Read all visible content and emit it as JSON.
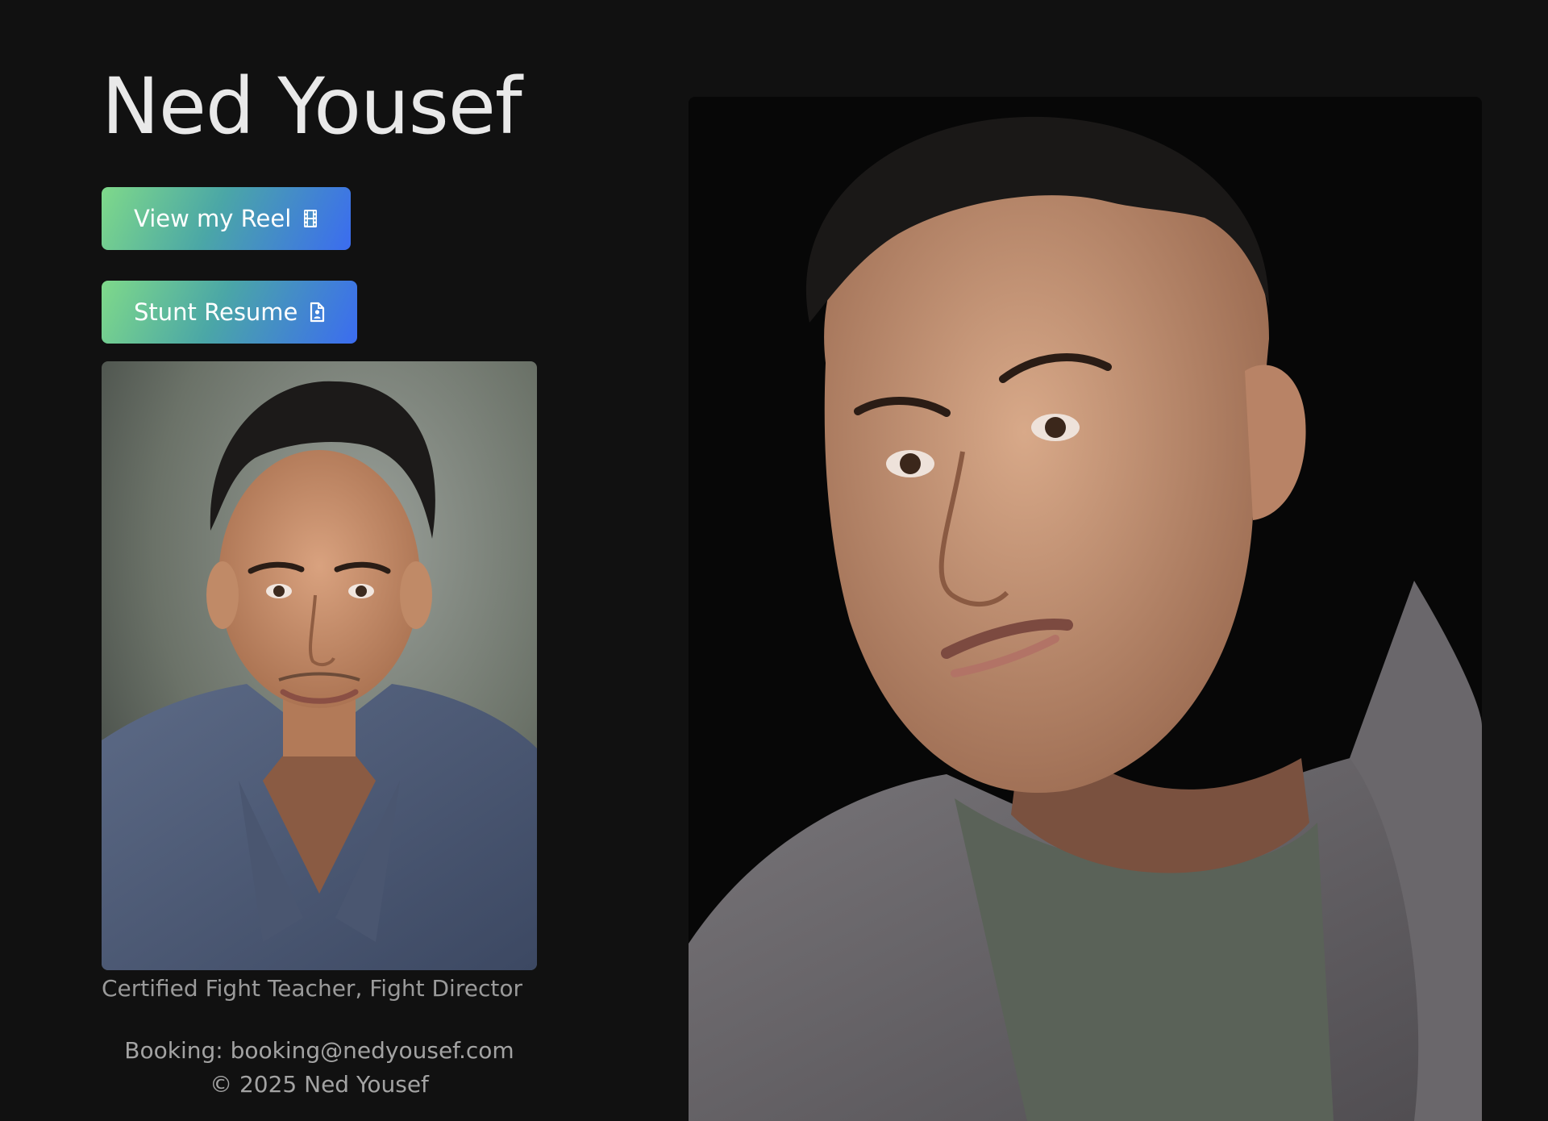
{
  "site": {
    "title": "Ned Yousef"
  },
  "buttons": {
    "reel_label": "View my Reel",
    "resume_label": "Stunt Resume"
  },
  "profile": {
    "caption": "Certified Fight Teacher, Fight Director"
  },
  "footer": {
    "booking": "Booking: booking@nedyousef.com",
    "copyright": "© 2025 Ned Yousef"
  },
  "icons": {
    "reel": "film-icon",
    "resume": "document-user-icon"
  },
  "colors": {
    "background": "#111111",
    "button_gradient_start": "#7fd98a",
    "button_gradient_end": "#3b6cf0",
    "caption_text": "#9a9a9a"
  }
}
